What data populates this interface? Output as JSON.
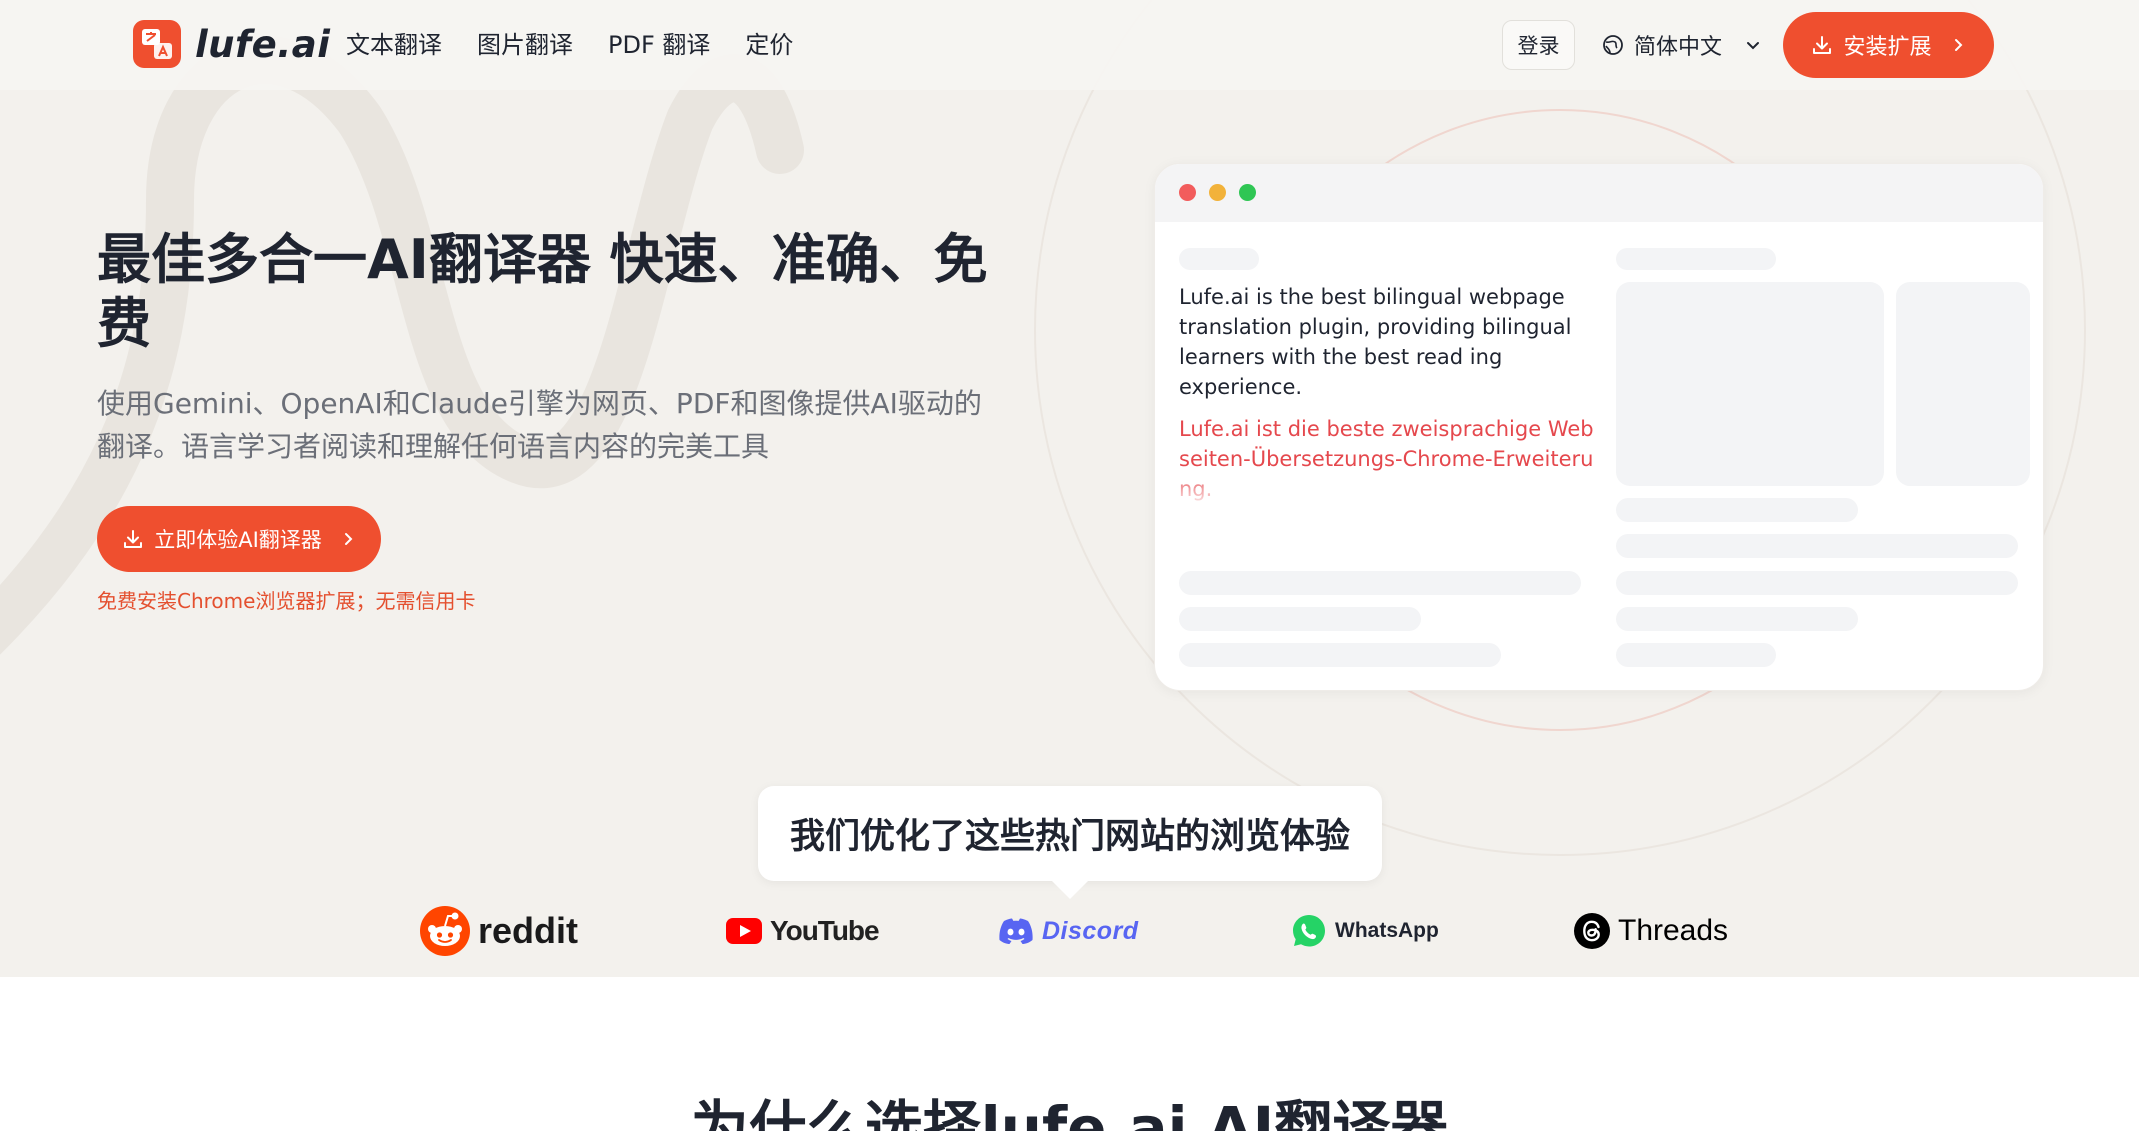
{
  "header": {
    "logo_text": "lufe.ai",
    "nav": [
      "文本翻译",
      "图片翻译",
      "PDF 翻译",
      "定价"
    ],
    "login_label": "登录",
    "language_label": "简体中文",
    "install_label": "安装扩展"
  },
  "hero": {
    "title": "最佳多合一AI翻译器 快速、准确、免费",
    "subtitle": "使用Gemini、OpenAI和Claude引擎为网页、PDF和图像提供AI驱动的翻译。语言学习者阅读和理解任何语言内容的完美工具",
    "cta_label": "立即体验AI翻译器",
    "cta_note": "免费安装Chrome浏览器扩展；无需信用卡"
  },
  "mock": {
    "source_text": "Lufe.ai is the best bilingual webpage translation plugin, providing bilingual learners with the best read ing experience.",
    "translated_text": "Lufe.ai ist die beste zweisprachige Webseiten-Übersetzungs-Chrome-Erweiterung."
  },
  "sites": {
    "tooltip": "我们优化了这些热门网站的浏览体验",
    "items": [
      {
        "label": "reddit",
        "icon": "reddit-icon",
        "color": "#ff4500"
      },
      {
        "label": "YouTube",
        "icon": "youtube-icon",
        "color": "#ff0000"
      },
      {
        "label": "Discord",
        "icon": "discord-icon",
        "color": "#5865f2"
      },
      {
        "label": "WhatsApp",
        "icon": "whatsapp-icon",
        "color": "#25d366"
      },
      {
        "label": "Threads",
        "icon": "threads-icon",
        "color": "#000000"
      }
    ]
  },
  "section": {
    "title": "为什么选择lufe.ai AI翻译器"
  },
  "colors": {
    "accent": "#ef4f2f",
    "background": "#f3f1ed",
    "text": "#1f2430"
  }
}
